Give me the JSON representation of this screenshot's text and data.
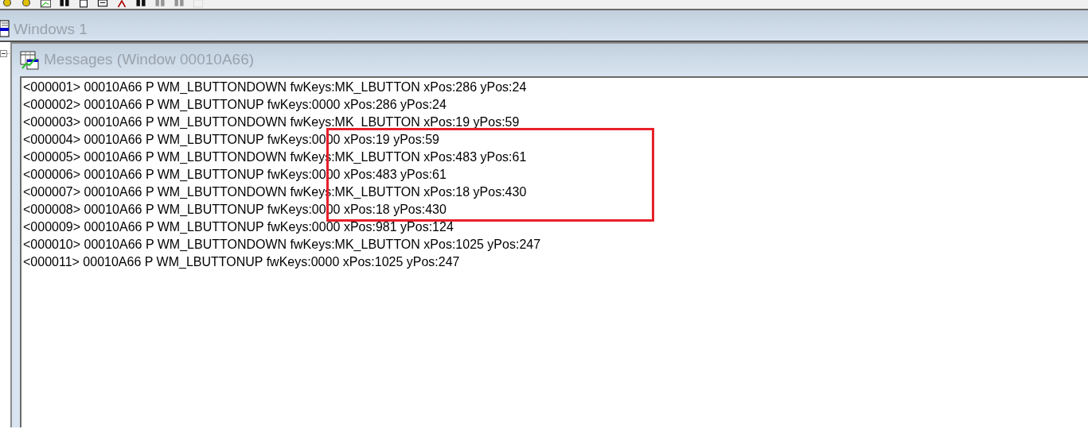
{
  "mdi_window": {
    "title": "Windows 1"
  },
  "messages_window": {
    "title": "Messages (Window 00010A66)",
    "rows": [
      {
        "text": "<000001> 00010A66 P WM_LBUTTONDOWN fwKeys:MK_LBUTTON xPos:286 yPos:24",
        "highlighted": false
      },
      {
        "text": "<000002> 00010A66 P WM_LBUTTONUP fwKeys:0000 xPos:286 yPos:24",
        "highlighted": false
      },
      {
        "text": "<000003> 00010A66 P WM_LBUTTONDOWN fwKeys:MK_LBUTTON xPos:19 yPos:59",
        "highlighted": false
      },
      {
        "text": "<000004> 00010A66 P WM_LBUTTONUP fwKeys:0000 xPos:19 yPos:59",
        "highlighted": true
      },
      {
        "text": "<000005> 00010A66 P WM_LBUTTONDOWN fwKeys:MK_LBUTTON xPos:483 yPos:61",
        "highlighted": true
      },
      {
        "text": "<000006> 00010A66 P WM_LBUTTONUP fwKeys:0000 xPos:483 yPos:61",
        "highlighted": true
      },
      {
        "text": "<000007> 00010A66 P WM_LBUTTONDOWN fwKeys:MK_LBUTTON xPos:18 yPos:430",
        "highlighted": true
      },
      {
        "text": "<000008> 00010A66 P WM_LBUTTONUP fwKeys:0000 xPos:18 yPos:430",
        "highlighted": true
      },
      {
        "text": "<000009> 00010A66 P WM_LBUTTONUP fwKeys:0000 xPos:981 yPos:124",
        "highlighted": false
      },
      {
        "text": "<000010> 00010A66 P WM_LBUTTONDOWN fwKeys:MK_LBUTTON xPos:1025 yPos:247",
        "highlighted": false
      },
      {
        "text": "<000011> 00010A66 P WM_LBUTTONUP fwKeys:0000 xPos:1025 yPos:247",
        "highlighted": false
      }
    ]
  }
}
